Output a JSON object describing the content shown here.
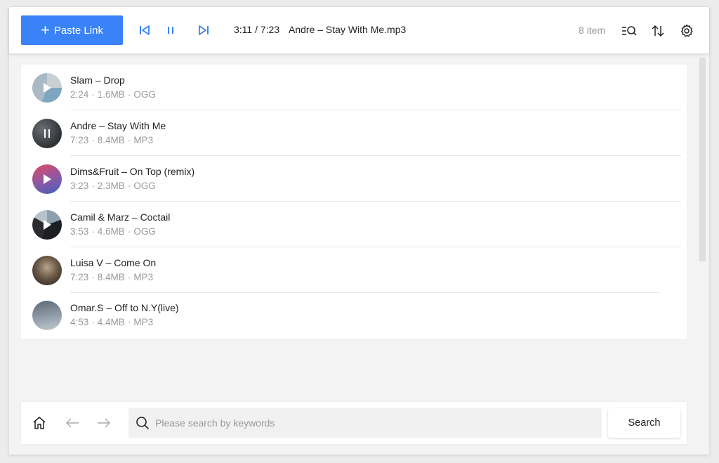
{
  "toolbar": {
    "paste_link_label": "Paste Link",
    "current_time": "3:11 / 7:23",
    "current_title": "Andre – Stay With Me.mp3",
    "item_count": "8 item",
    "accent": "#3a82f7"
  },
  "tracks": [
    {
      "title": "Slam – Drop",
      "duration": "2:24",
      "size": "1.6MB",
      "format": "OGG",
      "state": "play",
      "icon": "play-icon",
      "art_colors": [
        "#a9b9c6",
        "#7fa6bf",
        "#c9d0d3"
      ]
    },
    {
      "title": "Andre – Stay With Me",
      "duration": "7:23",
      "size": "8.4MB",
      "format": "MP3",
      "state": "pause",
      "icon": "pause-icon",
      "art_colors": [
        "#4a4d52",
        "#2e3135",
        "#6a6f75"
      ]
    },
    {
      "title": "Dims&Fruit – On Top (remix)",
      "duration": "3:23",
      "size": "2.3MB",
      "format": "OGG",
      "state": "play",
      "icon": "play-icon",
      "art_colors": [
        "#d64a6a",
        "#7d5aa8",
        "#4a5fb0"
      ]
    },
    {
      "title": "Camil & Marz – Coctail",
      "duration": "3:53",
      "size": "4.6MB",
      "format": "OGG",
      "state": "play",
      "icon": "play-icon",
      "art_colors": [
        "#2a2c30",
        "#8fa0ad",
        "#1c1e22"
      ]
    },
    {
      "title": "Luisa V – Come On",
      "duration": "7:23",
      "size": "8.4MB",
      "format": "MP3",
      "state": "none",
      "icon": "album-art",
      "art_colors": [
        "#6b5a48",
        "#3d3328",
        "#b8a48a"
      ]
    },
    {
      "title": "Omar.S – Off to N.Y(live)",
      "duration": "4:53",
      "size": "4.4MB",
      "format": "MP3",
      "state": "none",
      "icon": "album-art",
      "art_colors": [
        "#8d99a6",
        "#5c6773",
        "#c3cbd2"
      ]
    }
  ],
  "search": {
    "placeholder": "Please search by keywords",
    "value": "",
    "button_label": "Search"
  }
}
